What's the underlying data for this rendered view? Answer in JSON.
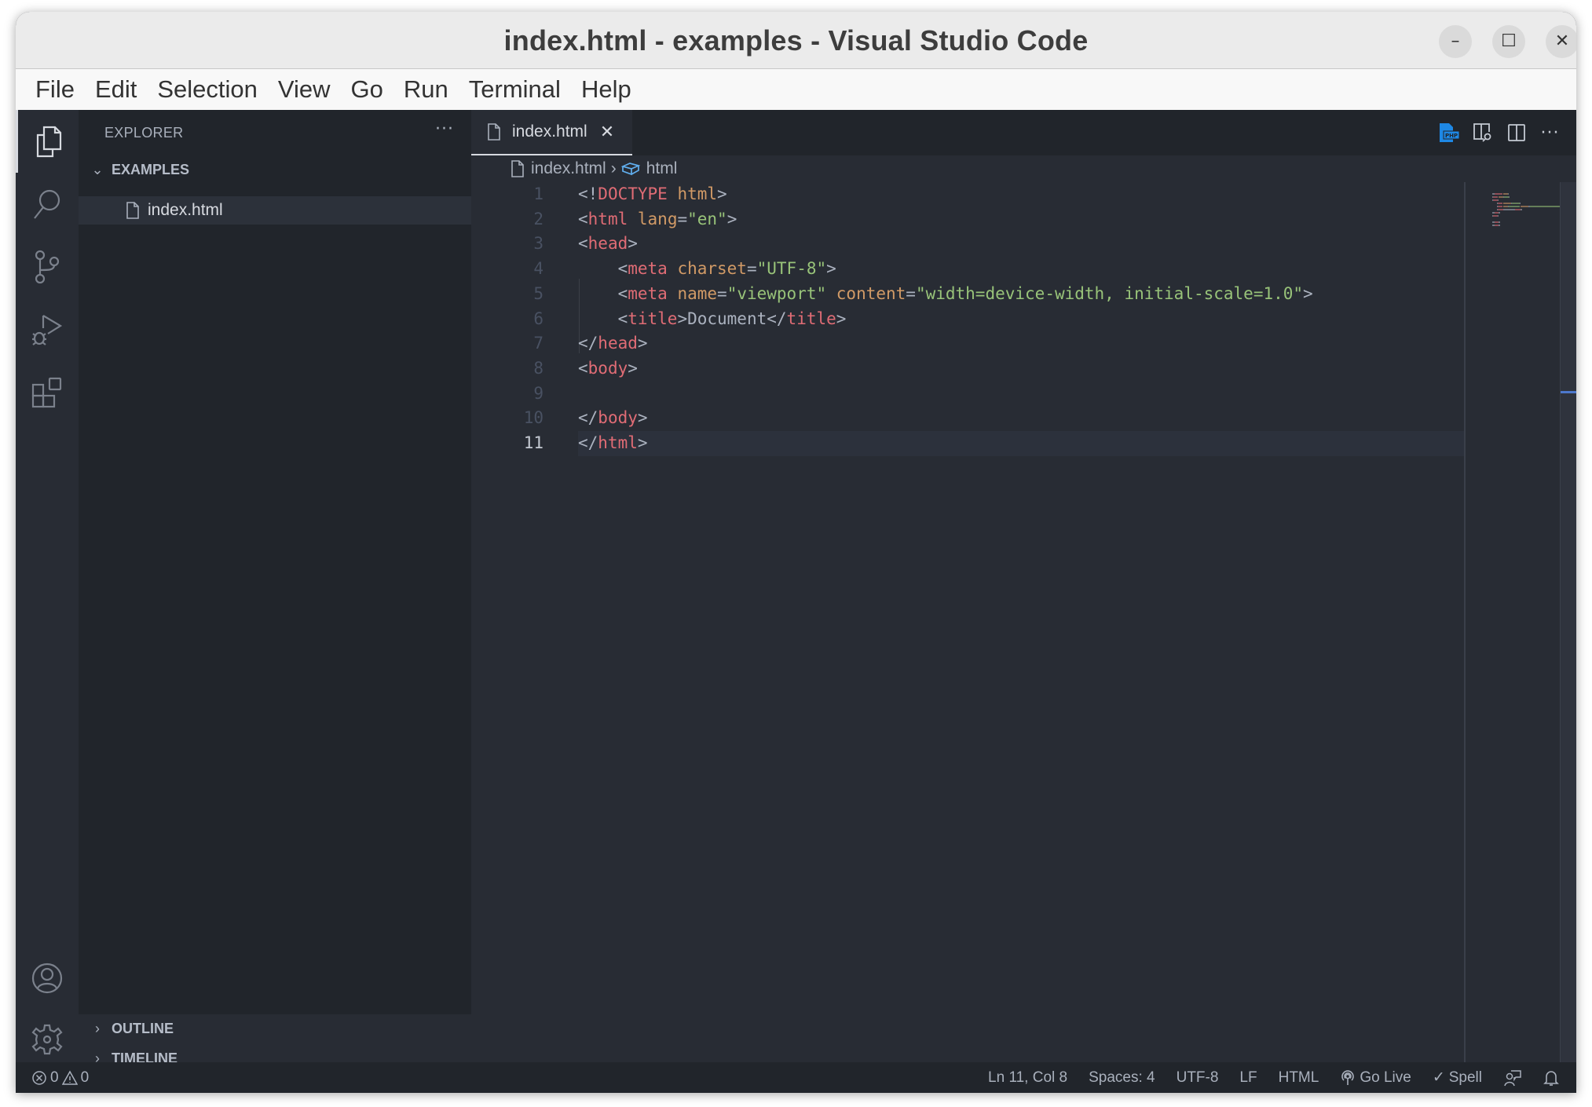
{
  "window": {
    "title": "index.html - examples - Visual Studio Code",
    "controls": {
      "minimize": "–",
      "maximize": "☐",
      "close": "✕"
    }
  },
  "menu": [
    "File",
    "Edit",
    "Selection",
    "View",
    "Go",
    "Run",
    "Terminal",
    "Help"
  ],
  "activity_bar": {
    "items": [
      "explorer-icon",
      "search-icon",
      "source-control-icon",
      "run-debug-icon",
      "extensions-icon"
    ],
    "bottom": [
      "accounts-icon",
      "settings-gear-icon"
    ]
  },
  "sidebar": {
    "title": "EXPLORER",
    "more": "···",
    "folder": {
      "name": "EXAMPLES",
      "expanded": true,
      "chevron": "⌄"
    },
    "files": [
      {
        "name": "index.html",
        "selected": true
      }
    ],
    "sections": [
      {
        "name": "OUTLINE",
        "chevron": "›"
      },
      {
        "name": "TIMELINE",
        "chevron": "›"
      }
    ]
  },
  "editor": {
    "tabs": [
      {
        "label": "index.html",
        "active": true,
        "close": "✕"
      }
    ],
    "actions": [
      "php-file-icon",
      "open-preview-icon",
      "split-editor-icon",
      "more-actions-icon"
    ],
    "more": "···",
    "breadcrumb": {
      "file": "index.html",
      "separator": "›",
      "symbol": "html"
    },
    "current_line": 11,
    "lines": [
      {
        "n": "1",
        "tokens": [
          [
            "punc",
            "<!"
          ],
          [
            "tag",
            "DOCTYPE"
          ],
          [
            "punc",
            " "
          ],
          [
            "attr",
            "html"
          ],
          [
            "punc",
            ">"
          ]
        ]
      },
      {
        "n": "2",
        "tokens": [
          [
            "punc",
            "<"
          ],
          [
            "tag",
            "html"
          ],
          [
            "punc",
            " "
          ],
          [
            "attr",
            "lang"
          ],
          [
            "punc",
            "="
          ],
          [
            "str",
            "\"en\""
          ],
          [
            "punc",
            ">"
          ]
        ]
      },
      {
        "n": "3",
        "tokens": [
          [
            "punc",
            "<"
          ],
          [
            "tag",
            "head"
          ],
          [
            "punc",
            ">"
          ]
        ]
      },
      {
        "n": "4",
        "tokens": [
          [
            "punc",
            "    <"
          ],
          [
            "tag",
            "meta"
          ],
          [
            "punc",
            " "
          ],
          [
            "attr",
            "charset"
          ],
          [
            "punc",
            "="
          ],
          [
            "str",
            "\"UTF-8\""
          ],
          [
            "punc",
            ">"
          ]
        ]
      },
      {
        "n": "5",
        "tokens": [
          [
            "punc",
            "    <"
          ],
          [
            "tag",
            "meta"
          ],
          [
            "punc",
            " "
          ],
          [
            "attr",
            "name"
          ],
          [
            "punc",
            "="
          ],
          [
            "str",
            "\"viewport\""
          ],
          [
            "punc",
            " "
          ],
          [
            "attr",
            "content"
          ],
          [
            "punc",
            "="
          ],
          [
            "str",
            "\"width=device-width, initial-scale=1.0\""
          ],
          [
            "punc",
            ">"
          ]
        ]
      },
      {
        "n": "6",
        "tokens": [
          [
            "punc",
            "    <"
          ],
          [
            "tag",
            "title"
          ],
          [
            "punc",
            ">"
          ],
          [
            "text",
            "Document"
          ],
          [
            "punc",
            "</"
          ],
          [
            "tag",
            "title"
          ],
          [
            "punc",
            ">"
          ]
        ]
      },
      {
        "n": "7",
        "tokens": [
          [
            "punc",
            "</"
          ],
          [
            "tag",
            "head"
          ],
          [
            "punc",
            ">"
          ]
        ]
      },
      {
        "n": "8",
        "tokens": [
          [
            "punc",
            "<"
          ],
          [
            "tag",
            "body"
          ],
          [
            "punc",
            ">"
          ]
        ]
      },
      {
        "n": "9",
        "tokens": []
      },
      {
        "n": "10",
        "tokens": [
          [
            "punc",
            "</"
          ],
          [
            "tag",
            "body"
          ],
          [
            "punc",
            ">"
          ]
        ]
      },
      {
        "n": "11",
        "tokens": [
          [
            "punc",
            "</"
          ],
          [
            "tag",
            "html"
          ],
          [
            "punc",
            ">"
          ]
        ]
      }
    ]
  },
  "status_bar": {
    "errors": "0",
    "warnings": "0",
    "position": "Ln 11, Col 8",
    "indentation": "Spaces: 4",
    "encoding": "UTF-8",
    "eol": "LF",
    "language": "HTML",
    "go_live": "Go Live",
    "spell": "Spell",
    "spell_check": "✓"
  },
  "colors": {
    "tag": "#e06c75",
    "attr": "#d19a66",
    "string": "#98c379",
    "punctuation": "#abb2bf",
    "accent": "#4d78cc",
    "php_icon": "#1e88e5"
  }
}
